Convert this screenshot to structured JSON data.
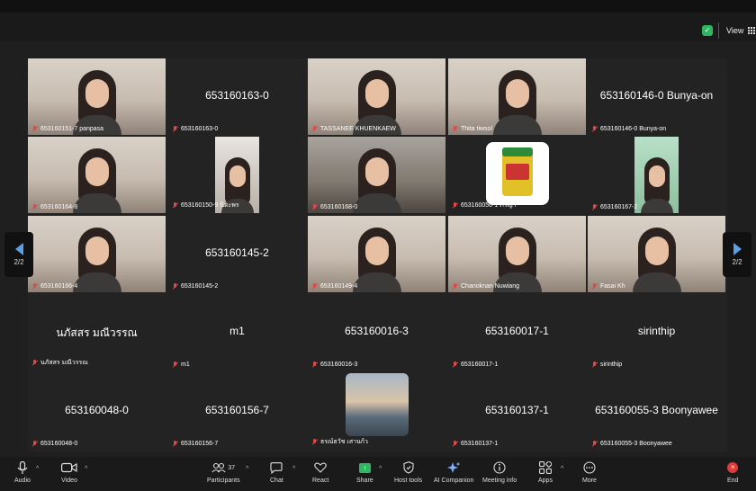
{
  "header": {
    "view_label": "View"
  },
  "colors": {
    "background": "#1f1f1f",
    "accent_blue": "#5aa0e6",
    "share_green": "#2fb660",
    "end_red": "#e03b3b",
    "muted_red": "#e34848"
  },
  "gallery": {
    "page_indicator_left": "2/2",
    "page_indicator_right": "2/2",
    "tiles": [
      {
        "label": "653160151-7 panpasa",
        "center_name": "",
        "type": "video"
      },
      {
        "label": "653160163-0",
        "center_name": "653160163-0",
        "type": "name"
      },
      {
        "label": "TASSANEE KHUENKAEW",
        "center_name": "",
        "type": "video"
      },
      {
        "label": "Thita tiwsol",
        "center_name": "",
        "type": "video"
      },
      {
        "label": "653160146-0 Bunya-on",
        "center_name": "653160146-0 Bunya-on",
        "type": "name"
      },
      {
        "label": "653160164-8",
        "center_name": "",
        "type": "video"
      },
      {
        "label": "653160150-9 นิตะพร",
        "center_name": "",
        "type": "narrow"
      },
      {
        "label": "653160168-0",
        "center_name": "",
        "type": "video"
      },
      {
        "label": "653160056-1 ภัรญา",
        "center_name": "",
        "type": "jar"
      },
      {
        "label": "653160167-2",
        "center_name": "",
        "type": "narrow-green"
      },
      {
        "label": "653160166-4",
        "center_name": "",
        "type": "video"
      },
      {
        "label": "653160145-2",
        "center_name": "653160145-2",
        "type": "name"
      },
      {
        "label": "653160149-4",
        "center_name": "",
        "type": "video"
      },
      {
        "label": "Chanoknan Nuwiang",
        "center_name": "",
        "type": "video"
      },
      {
        "label": "Fasai Kh",
        "center_name": "",
        "type": "video"
      },
      {
        "label": "นภัสสร มณีวรรณ",
        "center_name": "นภัสสร มณีวรรณ",
        "type": "name"
      },
      {
        "label": "m1",
        "center_name": "m1",
        "type": "name"
      },
      {
        "label": "653160016-3",
        "center_name": "653160016-3",
        "type": "name"
      },
      {
        "label": "653160017-1",
        "center_name": "653160017-1",
        "type": "name"
      },
      {
        "label": "sirinthip",
        "center_name": "sirinthip",
        "type": "name"
      },
      {
        "label": "653160048-0",
        "center_name": "653160048-0",
        "type": "name"
      },
      {
        "label": "653160156-7",
        "center_name": "653160156-7",
        "type": "name"
      },
      {
        "label": "ธรณ์ธวัช เสานก้ว",
        "center_name": "",
        "type": "photo"
      },
      {
        "label": "653160137-1",
        "center_name": "653160137-1",
        "type": "name"
      },
      {
        "label": "653160055-3 Boonyawee",
        "center_name": "653160055-3 Boonyawee",
        "type": "name"
      }
    ]
  },
  "toolbar": {
    "audio": "Audio",
    "video": "Video",
    "participants": "Participants",
    "participants_count": "37",
    "chat": "Chat",
    "react": "React",
    "share": "Share",
    "host_tools": "Host tools",
    "ai_companion": "AI Companion",
    "meeting_info": "Meeting info",
    "apps": "Apps",
    "more": "More",
    "end": "End"
  }
}
